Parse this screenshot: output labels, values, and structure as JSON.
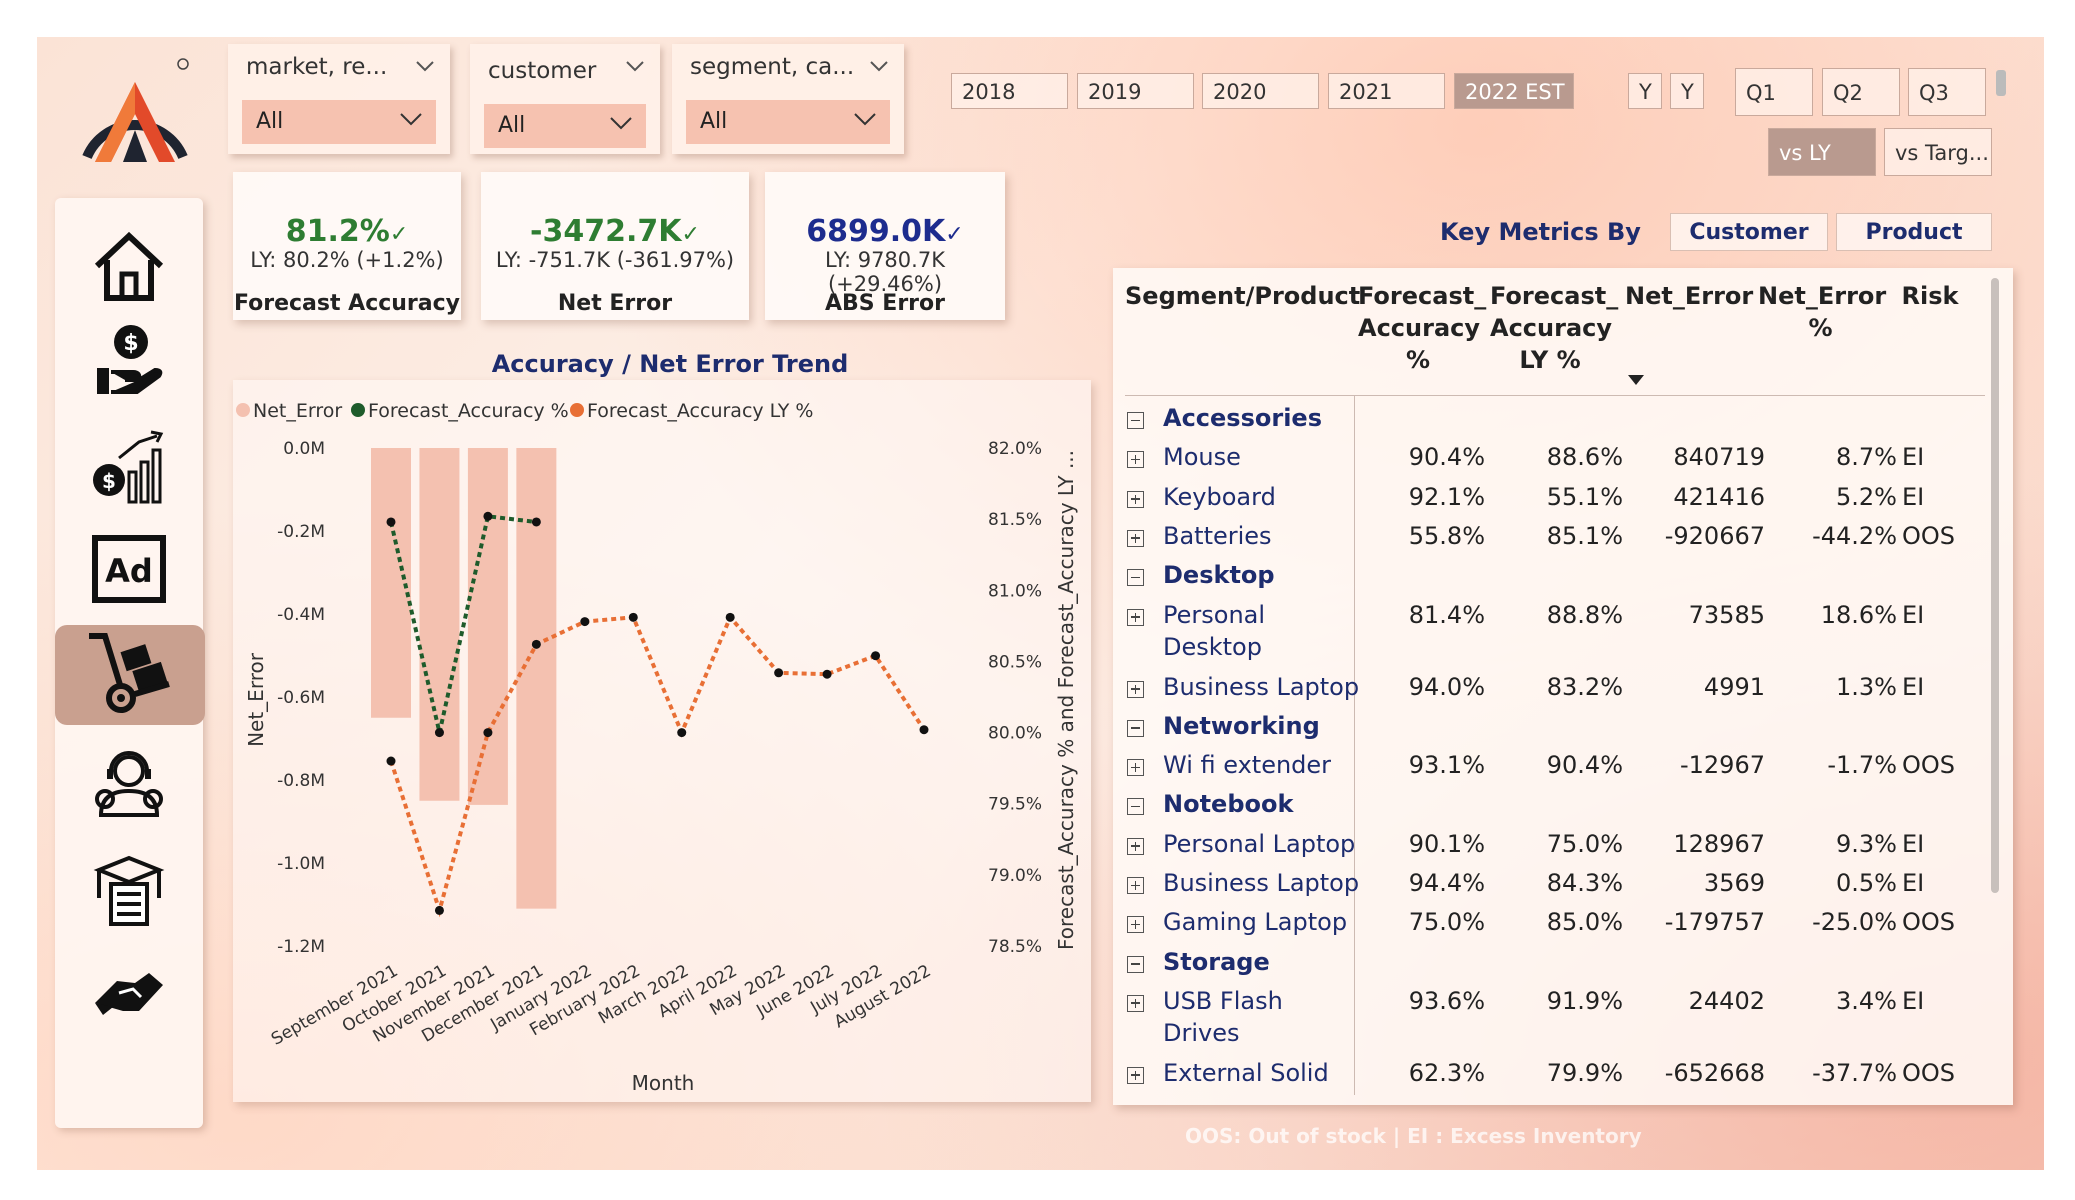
{
  "filters": {
    "market": {
      "title": "market, re...",
      "value": "All"
    },
    "customer": {
      "title": "customer",
      "value": "All"
    },
    "segment": {
      "title": "segment, ca...",
      "value": "All"
    }
  },
  "years": [
    "2018",
    "2019",
    "2020",
    "2021",
    "2022 EST"
  ],
  "selected_year": "2022 EST",
  "y_buttons": [
    "Y",
    "Y"
  ],
  "quarters": [
    "Q1",
    "Q2",
    "Q3"
  ],
  "compare": {
    "vs_ly": "vs LY",
    "vs_target": "vs Targ..."
  },
  "kpis": [
    {
      "value": "81.2%",
      "ly": "LY: 80.2% (+1.2%)",
      "label": "Forecast Accuracy",
      "color": "#2e7d32"
    },
    {
      "value": "-3472.7K",
      "ly": "LY: -751.7K (-361.97%)",
      "label": "Net Error",
      "color": "#2e7d32"
    },
    {
      "value": "6899.0K",
      "ly": "LY: 9780.7K (+29.46%)",
      "label": "ABS Error",
      "color": "#1d2c8e"
    }
  ],
  "sidebar": [
    "home-icon",
    "finance-icon",
    "sales-growth-icon",
    "marketing-ad-icon",
    "supply-chain-icon",
    "customer-support-icon",
    "inventory-checklist-icon",
    "partnership-handshake-icon"
  ],
  "chart_title": "Accuracy / Net Error Trend",
  "chart_data": {
    "type": "bar+line",
    "title": "Accuracy / Net Error Trend",
    "xlabel": "Month",
    "ylabel": "Net_Error",
    "y2label": "Forecast_Accuracy % and Forecast_Accuracy LY ...",
    "categories": [
      "September 2021",
      "October 2021",
      "November 2021",
      "December 2021",
      "January 2022",
      "February 2022",
      "March 2022",
      "April 2022",
      "May 2022",
      "June 2022",
      "July 2022",
      "August 2022"
    ],
    "yticks": [
      "0.0M",
      "-0.2M",
      "-0.4M",
      "-0.6M",
      "-0.8M",
      "-1.0M",
      "-1.2M"
    ],
    "ylim": [
      -1.2,
      0
    ],
    "y2ticks": [
      "82.0%",
      "81.5%",
      "81.0%",
      "80.5%",
      "80.0%",
      "79.5%",
      "79.0%",
      "78.5%"
    ],
    "y2lim": [
      78.5,
      82.0
    ],
    "legend": [
      "Net_Error",
      "Forecast_Accuracy %",
      "Forecast_Accuracy LY %"
    ],
    "colors": {
      "bar": "#f4c1b0",
      "accuracy": "#1e5b2b",
      "accuracy_ly": "#e86f35"
    },
    "series": [
      {
        "name": "Net_Error",
        "values": [
          -0.65,
          -0.85,
          -0.86,
          -1.11,
          null,
          null,
          null,
          null,
          null,
          null,
          null,
          null
        ]
      },
      {
        "name": "Forecast_Accuracy %",
        "values": [
          81.48,
          80.0,
          81.52,
          81.48,
          null,
          null,
          null,
          null,
          null,
          null,
          null,
          null
        ]
      },
      {
        "name": "Forecast_Accuracy LY %",
        "values": [
          79.8,
          78.75,
          80.0,
          80.62,
          80.78,
          80.81,
          80.0,
          80.81,
          80.42,
          80.41,
          80.54,
          80.02
        ]
      }
    ]
  },
  "table": {
    "title": "Key Metrics By",
    "toggles": [
      "Customer",
      "Product"
    ],
    "columns": [
      "Segment/Product",
      "Forecast_ Accuracy %",
      "Forecast_ Accuracy LY %",
      "Net_Error",
      "Net_Error %",
      "Risk"
    ],
    "rows": [
      {
        "type": "cat",
        "name": "Accessories"
      },
      {
        "type": "prod",
        "name": "Mouse",
        "fa": "90.4%",
        "faly": "88.6%",
        "ne": "840719",
        "nep": "8.7%",
        "risk": "EI"
      },
      {
        "type": "prod",
        "name": "Keyboard",
        "fa": "92.1%",
        "faly": "55.1%",
        "ne": "421416",
        "nep": "5.2%",
        "risk": "EI"
      },
      {
        "type": "prod",
        "name": "Batteries",
        "fa": "55.8%",
        "faly": "85.1%",
        "ne": "-920667",
        "nep": "-44.2%",
        "risk": "OOS"
      },
      {
        "type": "cat",
        "name": "Desktop"
      },
      {
        "type": "prod",
        "name": "Personal",
        "name2": "Desktop",
        "fa": "81.4%",
        "faly": "88.8%",
        "ne": "73585",
        "nep": "18.6%",
        "risk": "EI"
      },
      {
        "type": "prod",
        "name": "Business Laptop",
        "fa": "94.0%",
        "faly": "83.2%",
        "ne": "4991",
        "nep": "1.3%",
        "risk": "EI"
      },
      {
        "type": "cat",
        "name": "Networking"
      },
      {
        "type": "prod",
        "name": "Wi fi extender",
        "fa": "93.1%",
        "faly": "90.4%",
        "ne": "-12967",
        "nep": "-1.7%",
        "risk": "OOS"
      },
      {
        "type": "cat",
        "name": "Notebook"
      },
      {
        "type": "prod",
        "name": "Personal Laptop",
        "fa": "90.1%",
        "faly": "75.0%",
        "ne": "128967",
        "nep": "9.3%",
        "risk": "EI"
      },
      {
        "type": "prod",
        "name": "Business Laptop",
        "fa": "94.4%",
        "faly": "84.3%",
        "ne": "3569",
        "nep": "0.5%",
        "risk": "EI"
      },
      {
        "type": "prod",
        "name": "Gaming Laptop",
        "fa": "75.0%",
        "faly": "85.0%",
        "ne": "-179757",
        "nep": "-25.0%",
        "risk": "OOS"
      },
      {
        "type": "cat",
        "name": "Storage"
      },
      {
        "type": "prod",
        "name": "USB Flash",
        "name2": "Drives",
        "fa": "93.6%",
        "faly": "91.9%",
        "ne": "24402",
        "nep": "3.4%",
        "risk": "EI"
      },
      {
        "type": "prod",
        "name": "External Solid",
        "fa": "62.3%",
        "faly": "79.9%",
        "ne": "-652668",
        "nep": "-37.7%",
        "risk": "OOS"
      }
    ]
  },
  "footer_note": "OOS: Out of stock | EI : Excess Inventory"
}
